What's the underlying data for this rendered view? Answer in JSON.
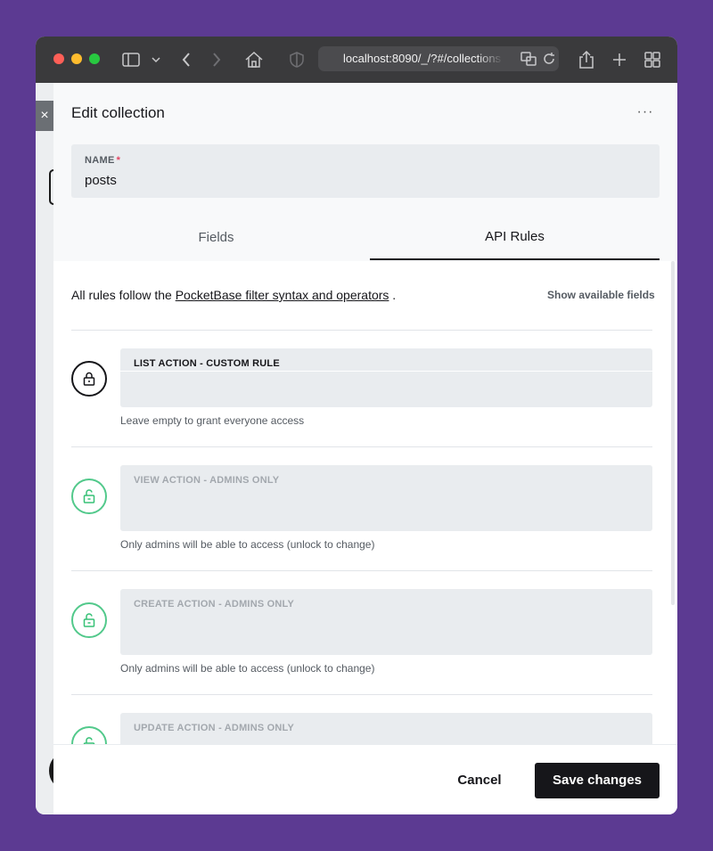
{
  "browser": {
    "url": "localhost:8090/_/?#/collections",
    "icons": [
      "sidebar-icon",
      "chevron-down-icon",
      "back-icon",
      "forward-icon",
      "home-icon",
      "shield-icon",
      "translate-icon",
      "reload-icon",
      "share-icon",
      "new-tab-icon",
      "tab-overview-icon"
    ]
  },
  "background": {
    "close_glyph": "×"
  },
  "panel": {
    "title": "Edit collection",
    "more_label": "···",
    "name_field": {
      "label": "NAME",
      "required_mark": "*",
      "value": "posts"
    },
    "tabs": [
      {
        "label": "Fields",
        "active": false
      },
      {
        "label": "API Rules",
        "active": true
      }
    ]
  },
  "api_rules": {
    "intro_prefix": "All rules follow the",
    "intro_link": "PocketBase filter syntax and operators",
    "intro_suffix": ".",
    "show_fields": "Show available fields",
    "rules": [
      {
        "label": "LIST ACTION - CUSTOM RULE",
        "help": "Leave empty to grant everyone access",
        "locked": true,
        "value": ""
      },
      {
        "label": "VIEW ACTION - ADMINS ONLY",
        "help": "Only admins will be able to access (unlock to change)",
        "locked": false
      },
      {
        "label": "CREATE ACTION - ADMINS ONLY",
        "help": "Only admins will be able to access (unlock to change)",
        "locked": false
      },
      {
        "label": "UPDATE ACTION - ADMINS ONLY",
        "help": "",
        "locked": false
      }
    ]
  },
  "footer": {
    "cancel_label": "Cancel",
    "save_label": "Save changes"
  },
  "colors": {
    "page_bg": "#5c3a92",
    "accent_dark": "#16161a",
    "unlocked_green": "#36c176",
    "required_red": "#e34562"
  }
}
